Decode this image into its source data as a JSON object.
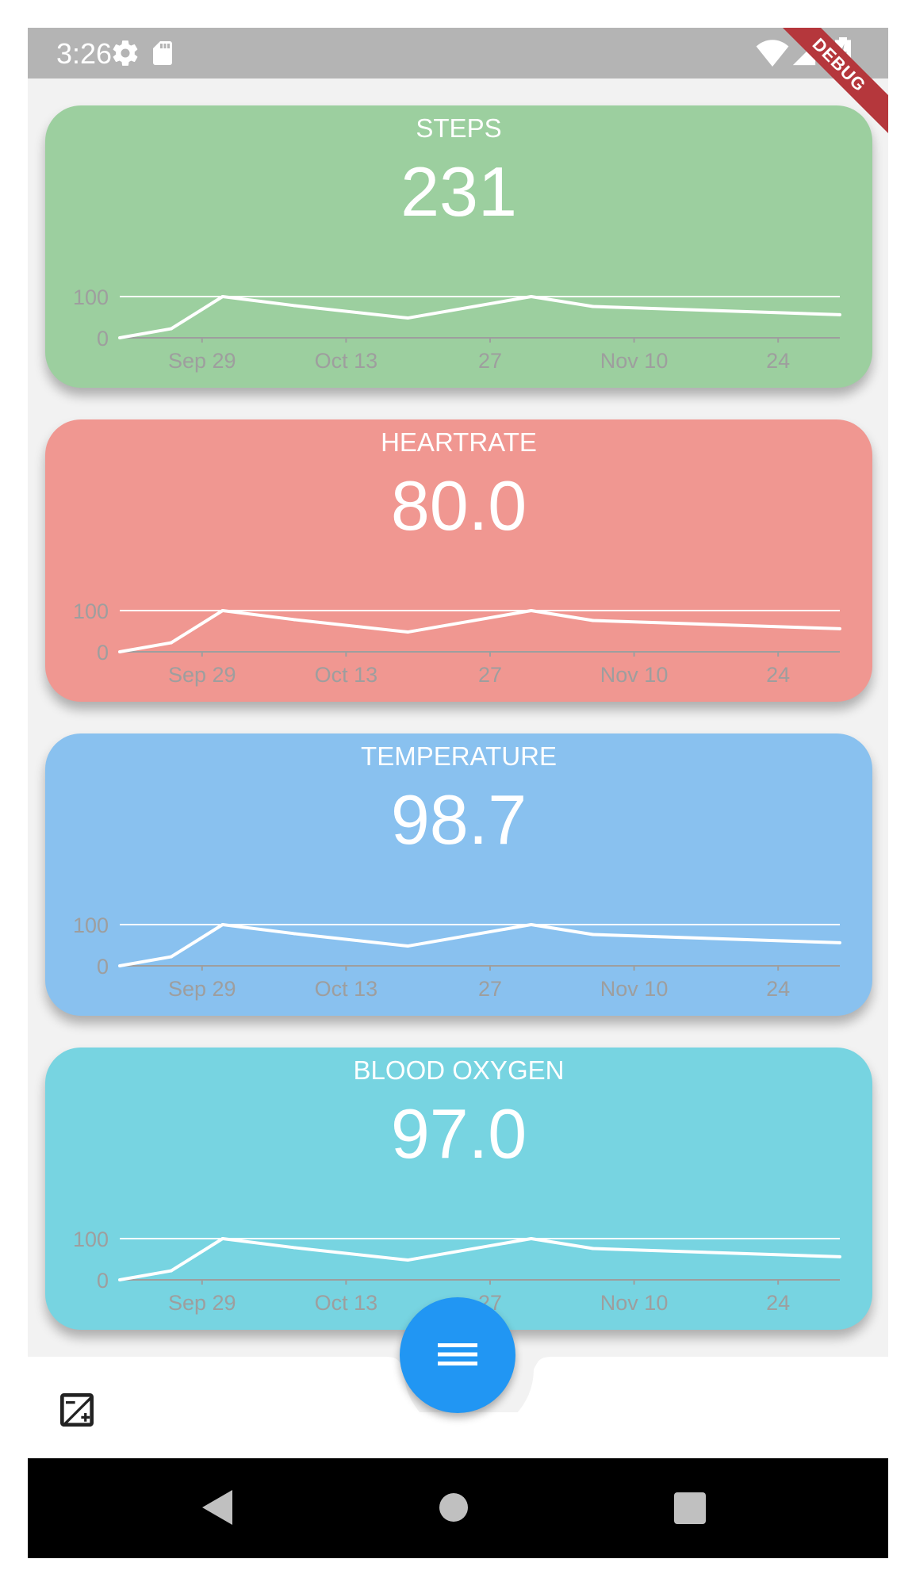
{
  "status_bar": {
    "time": "3:26",
    "icons": [
      "settings-icon",
      "sd-card-icon",
      "wifi-icon",
      "signal-icon",
      "battery-charging-icon"
    ],
    "debug_label": "DEBUG"
  },
  "cards": [
    {
      "title": "STEPS",
      "value": "231",
      "color": "#9ccf9f",
      "chart_data": {
        "type": "line",
        "x": [
          "Sep 21",
          "Sep 26",
          "Oct 1",
          "Oct 8",
          "Oct 19",
          "Oct 31",
          "Nov 6",
          "Nov 30"
        ],
        "series": [
          {
            "values": [
              0,
              22,
              100,
              78,
              48,
              100,
              76,
              56
            ]
          }
        ],
        "ylim": [
          0,
          100
        ],
        "y_ticks": [
          "100",
          "0"
        ],
        "x_tick_labels": [
          "Sep 29",
          "Oct 13",
          "27",
          "Nov 10",
          "24"
        ]
      }
    },
    {
      "title": "HEARTRATE",
      "value": "80.0",
      "color": "#f09791",
      "chart_data": {
        "type": "line",
        "x": [
          "Sep 21",
          "Sep 26",
          "Oct 1",
          "Oct 8",
          "Oct 19",
          "Oct 31",
          "Nov 6",
          "Nov 30"
        ],
        "series": [
          {
            "values": [
              0,
              22,
              100,
              78,
              48,
              100,
              76,
              56
            ]
          }
        ],
        "ylim": [
          0,
          100
        ],
        "y_ticks": [
          "100",
          "0"
        ],
        "x_tick_labels": [
          "Sep 29",
          "Oct 13",
          "27",
          "Nov 10",
          "24"
        ]
      }
    },
    {
      "title": "TEMPERATURE",
      "value": "98.7",
      "color": "#89c1ef",
      "chart_data": {
        "type": "line",
        "x": [
          "Sep 21",
          "Sep 26",
          "Oct 1",
          "Oct 8",
          "Oct 19",
          "Oct 31",
          "Nov 6",
          "Nov 30"
        ],
        "series": [
          {
            "values": [
              0,
              22,
              100,
              78,
              48,
              100,
              76,
              56
            ]
          }
        ],
        "ylim": [
          0,
          100
        ],
        "y_ticks": [
          "100",
          "0"
        ],
        "x_tick_labels": [
          "Sep 29",
          "Oct 13",
          "27",
          "Nov 10",
          "24"
        ]
      }
    },
    {
      "title": "BLOOD OXYGEN",
      "value": "97.0",
      "color": "#77d4e1",
      "chart_data": {
        "type": "line",
        "x": [
          "Sep 21",
          "Sep 26",
          "Oct 1",
          "Oct 8",
          "Oct 19",
          "Oct 31",
          "Nov 6",
          "Nov 30"
        ],
        "series": [
          {
            "values": [
              0,
              22,
              100,
              78,
              48,
              100,
              76,
              56
            ]
          }
        ],
        "ylim": [
          0,
          100
        ],
        "y_ticks": [
          "100",
          "0"
        ],
        "x_tick_labels": [
          "Sep 29",
          "Oct 13",
          "27",
          "Nov 10",
          "24"
        ]
      }
    }
  ],
  "chart_style": {
    "line_color": "#ffffff",
    "axis_color": "#9e9e9e",
    "label_color": "#9e9e9e"
  },
  "bottom_bar": {
    "left_icon": "exposure-icon",
    "fab_icon": "menu-icon",
    "fab_color": "#2196f3"
  },
  "nav_bar": {
    "buttons": [
      "back-icon",
      "home-icon",
      "recents-icon"
    ]
  }
}
